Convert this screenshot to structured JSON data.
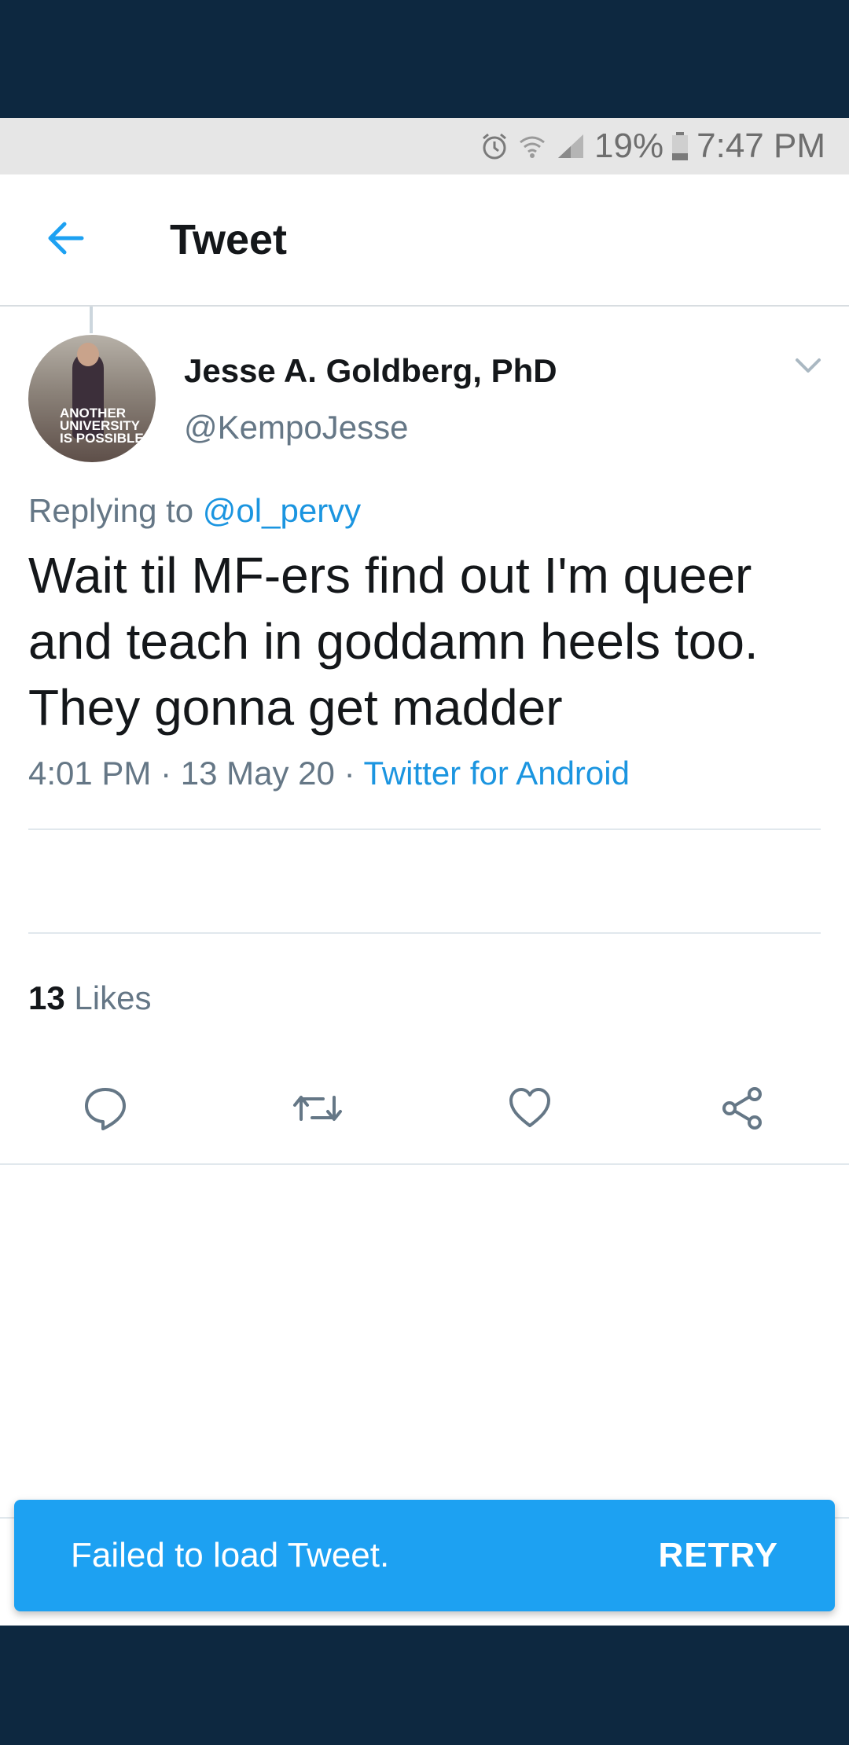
{
  "status_bar": {
    "battery": "19%",
    "time": "7:47 PM",
    "icons": [
      "alarm-icon",
      "wifi-icon",
      "signal-icon",
      "battery-icon"
    ]
  },
  "header": {
    "title": "Tweet",
    "back_icon": "back-arrow-icon"
  },
  "tweet": {
    "author_name": "Jesse A. Goldberg, PhD",
    "author_handle": "@KempoJesse",
    "avatar_text": [
      "ANOTHER",
      "UNIVERSITY",
      "IS POSSIBLE"
    ],
    "replying_label": "Replying to",
    "replying_to": "@ol_pervy",
    "text": "Wait til MF-ers find out I'm queer and teach in goddamn heels too. They gonna get madder",
    "time": "4:01 PM",
    "separator": "·",
    "date": "13 May 20",
    "source": "Twitter for Android",
    "likes_count": "13",
    "likes_label": "Likes"
  },
  "actions": [
    "reply-icon",
    "retweet-icon",
    "like-icon",
    "share-icon"
  ],
  "snackbar": {
    "message": "Failed to load Tweet.",
    "action": "RETRY"
  },
  "colors": {
    "accent": "#1da1f2",
    "link": "#1b95e0",
    "frame": "#0d2840",
    "text": "#14171a",
    "muted": "#657786"
  }
}
